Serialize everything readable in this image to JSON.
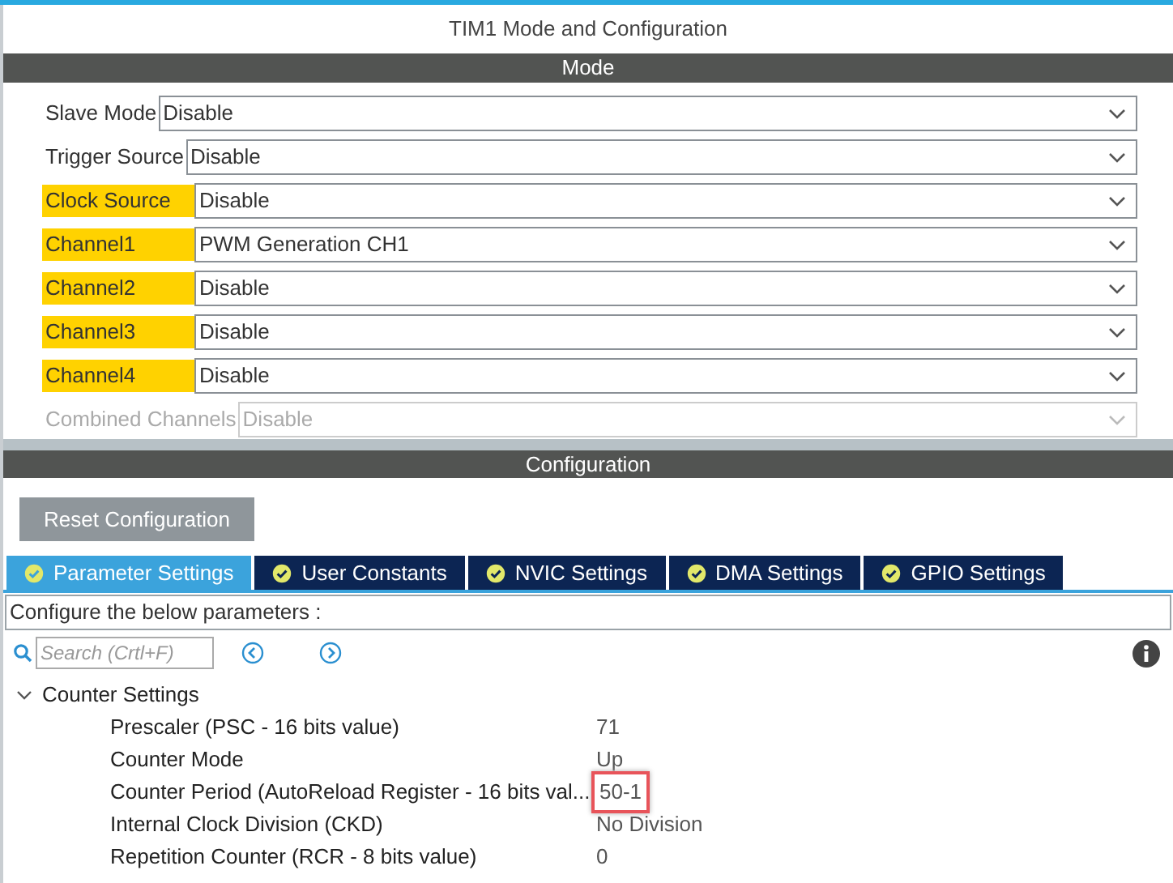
{
  "window": {
    "title": "TIM1 Mode and Configuration"
  },
  "mode": {
    "header": "Mode",
    "rows": [
      {
        "label": "Slave Mode",
        "value": "Disable",
        "highlighted": false,
        "disabled": false
      },
      {
        "label": "Trigger Source",
        "value": "Disable",
        "highlighted": false,
        "disabled": false
      },
      {
        "label": "Clock Source",
        "value": "Disable",
        "highlighted": true,
        "disabled": false
      },
      {
        "label": "Channel1",
        "value": "PWM Generation CH1",
        "highlighted": true,
        "disabled": false
      },
      {
        "label": "Channel2",
        "value": "Disable",
        "highlighted": true,
        "disabled": false
      },
      {
        "label": "Channel3",
        "value": "Disable",
        "highlighted": true,
        "disabled": false
      },
      {
        "label": "Channel4",
        "value": "Disable",
        "highlighted": true,
        "disabled": false
      },
      {
        "label": "Combined Channels",
        "value": "Disable",
        "highlighted": false,
        "disabled": true
      }
    ]
  },
  "configuration": {
    "header": "Configuration",
    "reset_button": "Reset Configuration",
    "tabs": [
      {
        "label": "Parameter Settings",
        "selected": true
      },
      {
        "label": "User Constants",
        "selected": false
      },
      {
        "label": "NVIC Settings",
        "selected": false
      },
      {
        "label": "DMA Settings",
        "selected": false
      },
      {
        "label": "GPIO Settings",
        "selected": false
      }
    ],
    "description": "Configure the below parameters :",
    "search": {
      "placeholder": "Search (Crtl+F)"
    },
    "groups": [
      {
        "label": "Counter Settings",
        "expanded": true,
        "children": [
          {
            "label": "Prescaler (PSC - 16 bits value)",
            "value": "71",
            "highlighted": false
          },
          {
            "label": "Counter Mode",
            "value": "Up",
            "highlighted": false
          },
          {
            "label": "Counter Period (AutoReload Register - 16 bits val...",
            "value": "50-1",
            "highlighted": true
          },
          {
            "label": "Internal Clock Division (CKD)",
            "value": "No Division",
            "highlighted": false
          },
          {
            "label": "Repetition Counter (RCR - 8 bits value)",
            "value": "0",
            "highlighted": false
          }
        ]
      }
    ]
  }
}
